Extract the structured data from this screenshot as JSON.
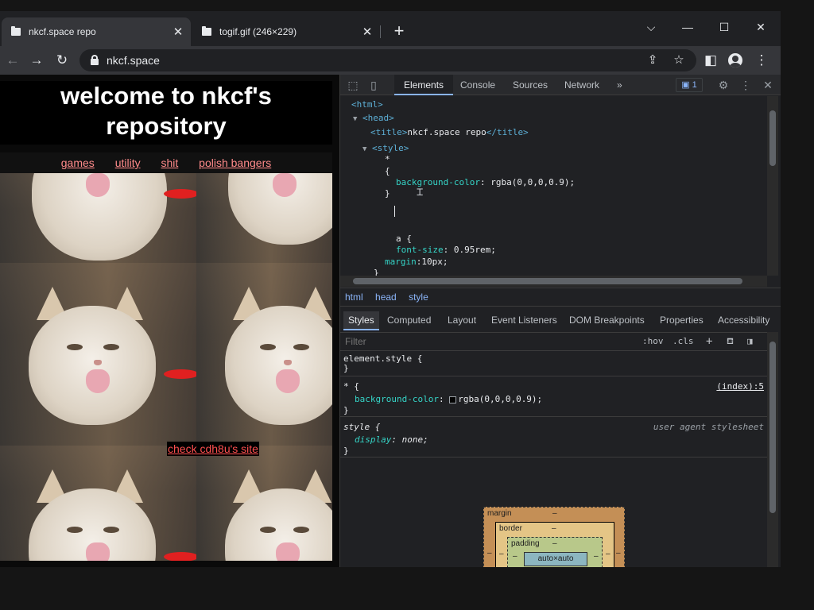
{
  "tabs": [
    {
      "title": "nkcf.space repo",
      "active": true
    },
    {
      "title": "togif.gif (246×229)",
      "active": false
    }
  ],
  "window_controls": {
    "dropdown": "⌵",
    "minimize": "—",
    "maximize": "☐",
    "close": "✕"
  },
  "tab_close_glyph": "✕",
  "newtab_glyph": "+",
  "toolbar": {
    "url": "nkcf.space",
    "back": "←",
    "forward": "→",
    "reload": "↻",
    "share": "⇪",
    "bookmark": "☆",
    "sidepanel": "◧",
    "menu": "⋮"
  },
  "page": {
    "heading_line1": "welcome to nkcf's",
    "heading_line2": "repository",
    "links": [
      "games",
      "utility",
      "shit",
      "polish bangers"
    ],
    "cdh_link": "check cdh8u's site"
  },
  "devtools": {
    "tabs": [
      "Elements",
      "Console",
      "Sources",
      "Network"
    ],
    "more_tabs": "»",
    "issues_count": "1",
    "code": {
      "html_open": "<html>",
      "head_open": "<head>",
      "title_open": "<title>",
      "title_text": "nkcf.space repo",
      "title_close": "</title>",
      "style_open": "<style>",
      "star": "*",
      "brace_open": "{",
      "bg_prop": "background-color",
      "bg_val": "rgba(0,0,0,0.9);",
      "brace_close": "}",
      "a_sel": "a {",
      "fs_prop": "font-size",
      "fs_val": "0.95rem;",
      "margin_prop": "margin",
      "margin_val": "10px;",
      "last_brace": "}"
    },
    "breadcrumbs": [
      "html",
      "head",
      "style"
    ],
    "sub_tabs": [
      "Styles",
      "Computed",
      "Layout",
      "Event Listeners",
      "DOM Breakpoints",
      "Properties",
      "Accessibility"
    ],
    "filter_placeholder": "Filter",
    "filter_buttons": {
      "hov": ":hov",
      "cls": ".cls",
      "add": "+"
    },
    "rules": {
      "element_style": "element.style {",
      "close": "}",
      "star_sel": "* {",
      "star_src": "(index):5",
      "star_prop": "background-color",
      "star_val": "rgba(0,0,0,0.9);",
      "style_sel": "style {",
      "style_src": "user agent stylesheet",
      "style_prop": "display",
      "style_val": "none;"
    },
    "box_model": {
      "margin_label": "margin",
      "border_label": "border",
      "padding_label": "padding",
      "content": "auto×auto",
      "dash": "–"
    }
  },
  "colors": {
    "link": "#ff8a8a",
    "cdh_link": "#ff5050",
    "devtools_accent": "#8ab4f8"
  }
}
